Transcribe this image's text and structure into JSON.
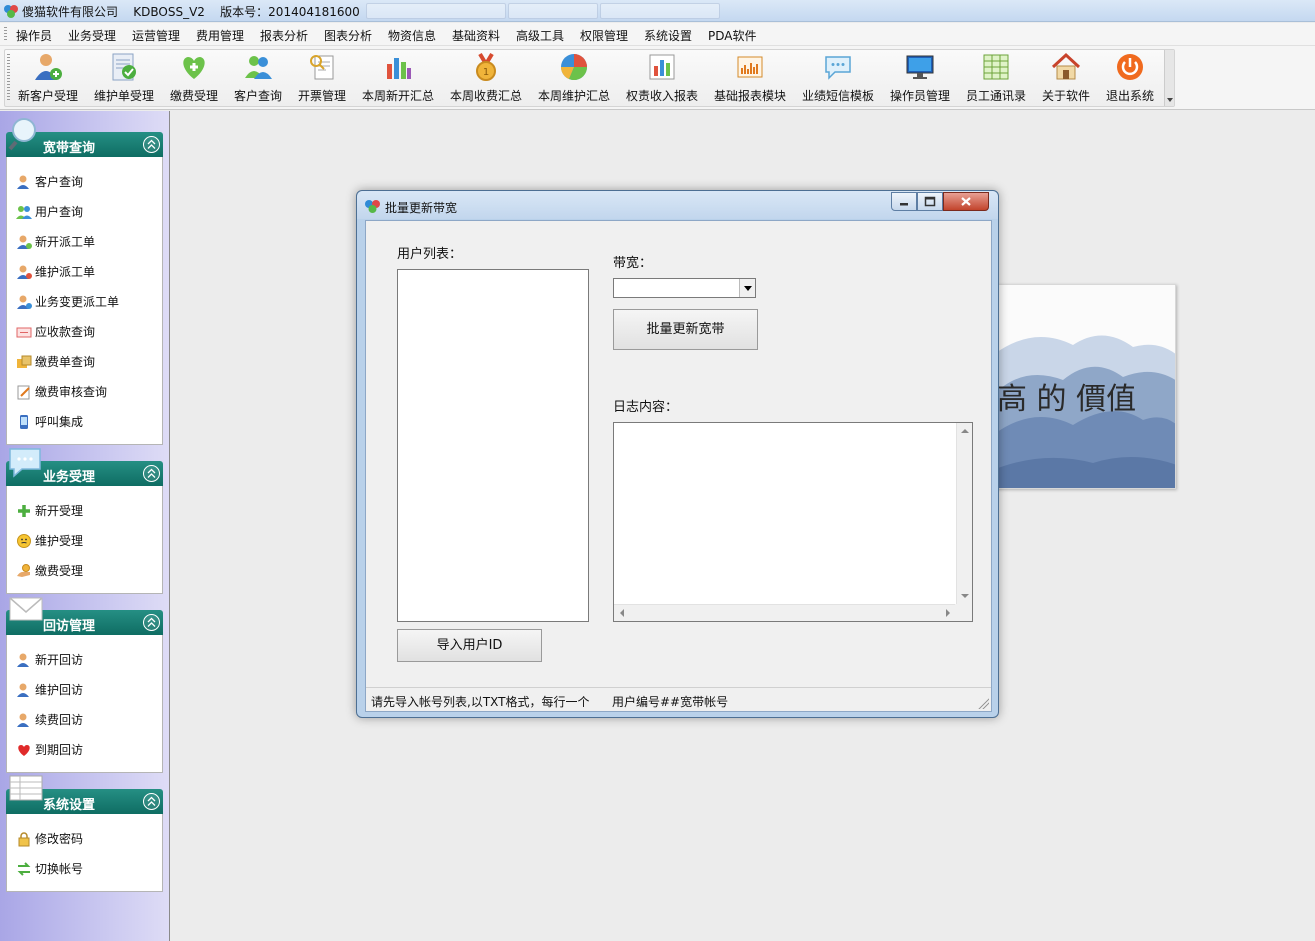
{
  "app": {
    "title": "傻猫软件有限公司    KDBOSS_V2    版本号：201404181600"
  },
  "menu": [
    "操作员",
    "业务受理",
    "运营管理",
    "费用管理",
    "报表分析",
    "图表分析",
    "物资信息",
    "基础资料",
    "高级工具",
    "权限管理",
    "系统设置",
    "PDA软件"
  ],
  "toolbar": [
    {
      "label": "新客户受理",
      "icon": "add-customer-icon"
    },
    {
      "label": "维护单受理",
      "icon": "maintenance-order-icon"
    },
    {
      "label": "缴费受理",
      "icon": "payment-heart-icon"
    },
    {
      "label": "客户查询",
      "icon": "customer-search-icon"
    },
    {
      "label": "开票管理",
      "icon": "invoice-icon"
    },
    {
      "label": "本周新开汇总",
      "icon": "weekly-new-chart-icon"
    },
    {
      "label": "本周收费汇总",
      "icon": "weekly-fee-medal-icon"
    },
    {
      "label": "本周维护汇总",
      "icon": "weekly-maintenance-pie-icon"
    },
    {
      "label": "权责收入报表",
      "icon": "income-report-icon"
    },
    {
      "label": "基础报表模块",
      "icon": "basic-report-icon"
    },
    {
      "label": "业绩短信模板",
      "icon": "sms-template-icon"
    },
    {
      "label": "操作员管理",
      "icon": "operator-monitor-icon"
    },
    {
      "label": "员工通讯录",
      "icon": "staff-directory-icon"
    },
    {
      "label": "关于软件",
      "icon": "home-icon"
    },
    {
      "label": "退出系统",
      "icon": "power-icon"
    }
  ],
  "sidebar": {
    "groups": [
      {
        "title": "宽带查询",
        "icon": "magnifier-icon",
        "items": [
          {
            "label": "客户查询",
            "icon": "customer-icon"
          },
          {
            "label": "用户查询",
            "icon": "users-icon"
          },
          {
            "label": "新开派工单",
            "icon": "new-dispatch-icon"
          },
          {
            "label": "维护派工单",
            "icon": "maintenance-dispatch-icon"
          },
          {
            "label": "业务变更派工单",
            "icon": "change-dispatch-icon"
          },
          {
            "label": "应收款查询",
            "icon": "receivable-icon"
          },
          {
            "label": "缴费单查询",
            "icon": "payment-slip-icon"
          },
          {
            "label": "缴费审核查询",
            "icon": "payment-audit-icon"
          },
          {
            "label": "呼叫集成",
            "icon": "phone-icon"
          }
        ]
      },
      {
        "title": "业务受理",
        "icon": "chat-bubble-icon",
        "items": [
          {
            "label": "新开受理",
            "icon": "plus-icon"
          },
          {
            "label": "维护受理",
            "icon": "smiley-icon"
          },
          {
            "label": "缴费受理",
            "icon": "hand-coin-icon"
          }
        ]
      },
      {
        "title": "回访管理",
        "icon": "envelope-icon",
        "items": [
          {
            "label": "新开回访",
            "icon": "customer-icon"
          },
          {
            "label": "维护回访",
            "icon": "customer-icon"
          },
          {
            "label": "续费回访",
            "icon": "customer-icon"
          },
          {
            "label": "到期回访",
            "icon": "heart-icon"
          }
        ]
      },
      {
        "title": "系统设置",
        "icon": "table-icon",
        "items": [
          {
            "label": "修改密码",
            "icon": "lock-icon"
          },
          {
            "label": "切换帐号",
            "icon": "switch-icon"
          }
        ]
      }
    ]
  },
  "background_art": {
    "text": "高 的  價值"
  },
  "dialog": {
    "title": "批量更新带宽",
    "user_list_label": "用户列表：",
    "bandwidth_label": "带宽：",
    "bandwidth_value": "",
    "update_button": "批量更新宽带",
    "log_label": "日志内容：",
    "log_value": "",
    "import_button": "导入用户ID",
    "status_left": "请先导入帐号列表,以TXT格式，每行一个",
    "status_right": "用户编号##宽带帐号"
  },
  "colors": {
    "sidebar_header": "#1a7f74",
    "title_bar": "#c4d8f0",
    "dialog_frame": "#b9d1ea",
    "close_button": "#c2442c"
  }
}
